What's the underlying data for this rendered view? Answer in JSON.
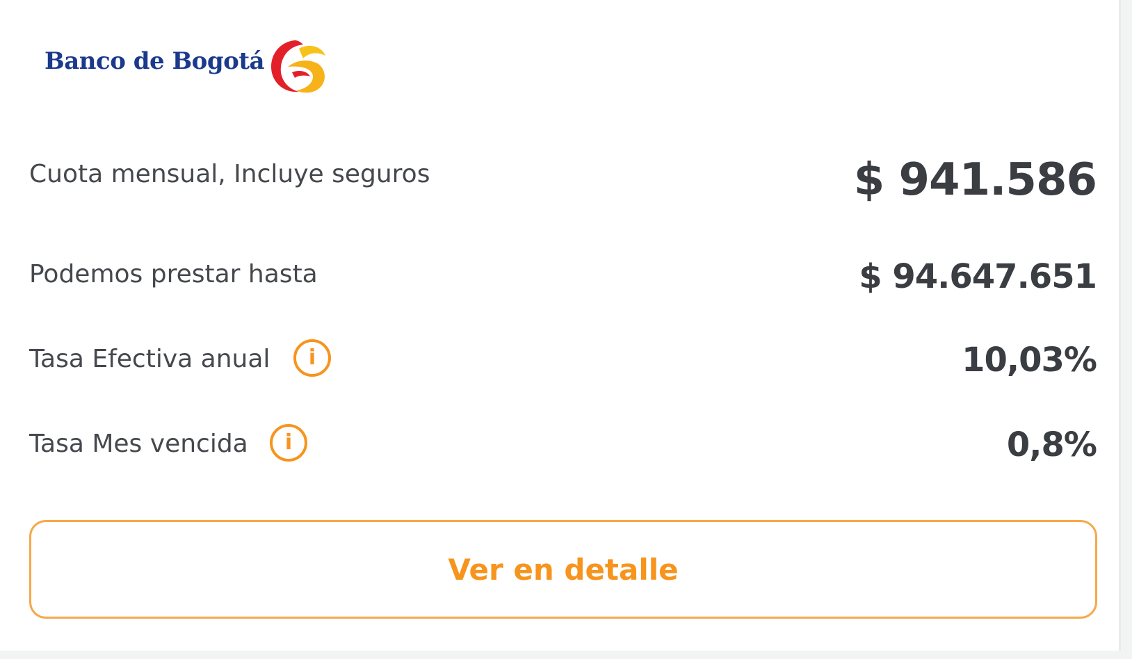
{
  "bank": {
    "name": "Banco de Bogotá",
    "logo_icon": "banco-de-bogota-logo-icon"
  },
  "rows": [
    {
      "label": "Cuota mensual, Incluye seguros",
      "value": "$ 941.586"
    },
    {
      "label": "Podemos prestar hasta",
      "value": "$ 94.647.651"
    },
    {
      "label": "Tasa Efectiva anual",
      "value": "10,03%",
      "icon": "info-icon"
    },
    {
      "label": "Tasa Mes vencida",
      "value": "0,8%",
      "icon": "info-icon"
    }
  ],
  "info_glyph": "i",
  "button": {
    "label": "Ver en detalle"
  },
  "colors": {
    "accent": "#f7941d",
    "brand_blue": "#1b3a8c",
    "text": "#45484c",
    "value_text": "#3a3d42"
  }
}
